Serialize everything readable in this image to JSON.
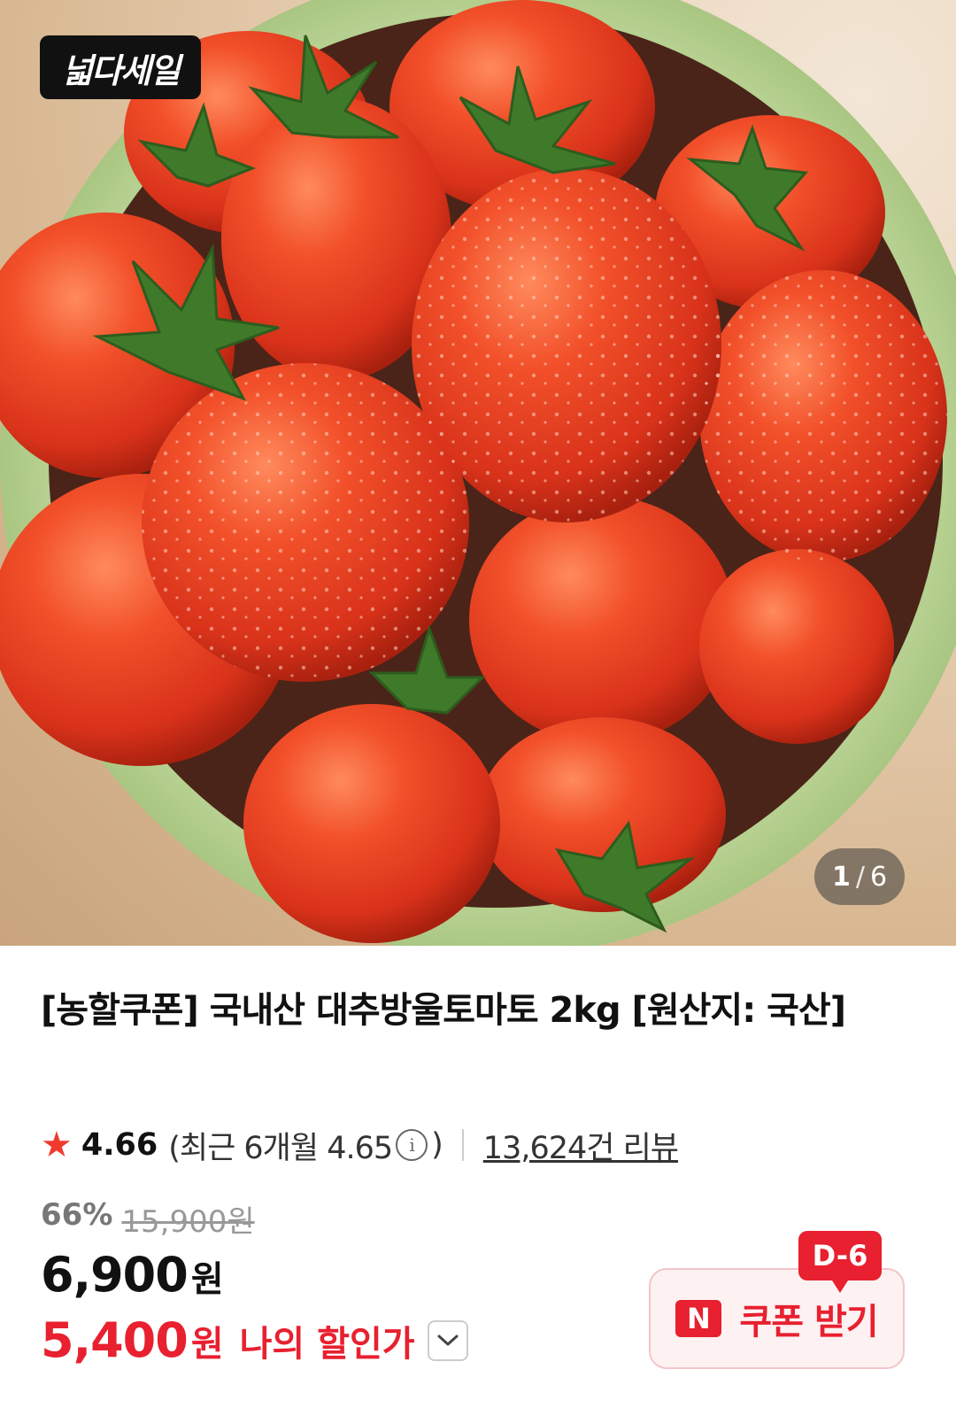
{
  "hero": {
    "badge_label": "넓다세일",
    "image_index": "1",
    "image_separator": "/",
    "image_total": "6"
  },
  "product": {
    "title": "[농할쿠폰] 국내산 대추방울토마토 2kg [원산지: 국산]",
    "rating": "4.66",
    "recent_rating_text": "(최근 6개월 4.65",
    "recent_rating_close": ")",
    "review_count": "13,624건 리뷰",
    "discount_pct": "66%",
    "original_price": "15,900원",
    "price_value": "6,900",
    "price_unit": "원",
    "my_price_value": "5,400",
    "my_price_unit": "원",
    "my_price_label": "나의 할인가"
  },
  "coupon": {
    "d_day": "D-6",
    "logo_letter": "N",
    "label": "쿠폰 받기"
  },
  "colors": {
    "accent_red": "#e8202f",
    "star": "#f03a2e"
  },
  "icons": [
    "star-icon",
    "info-icon",
    "chevron-down-icon",
    "naver-n-icon"
  ]
}
